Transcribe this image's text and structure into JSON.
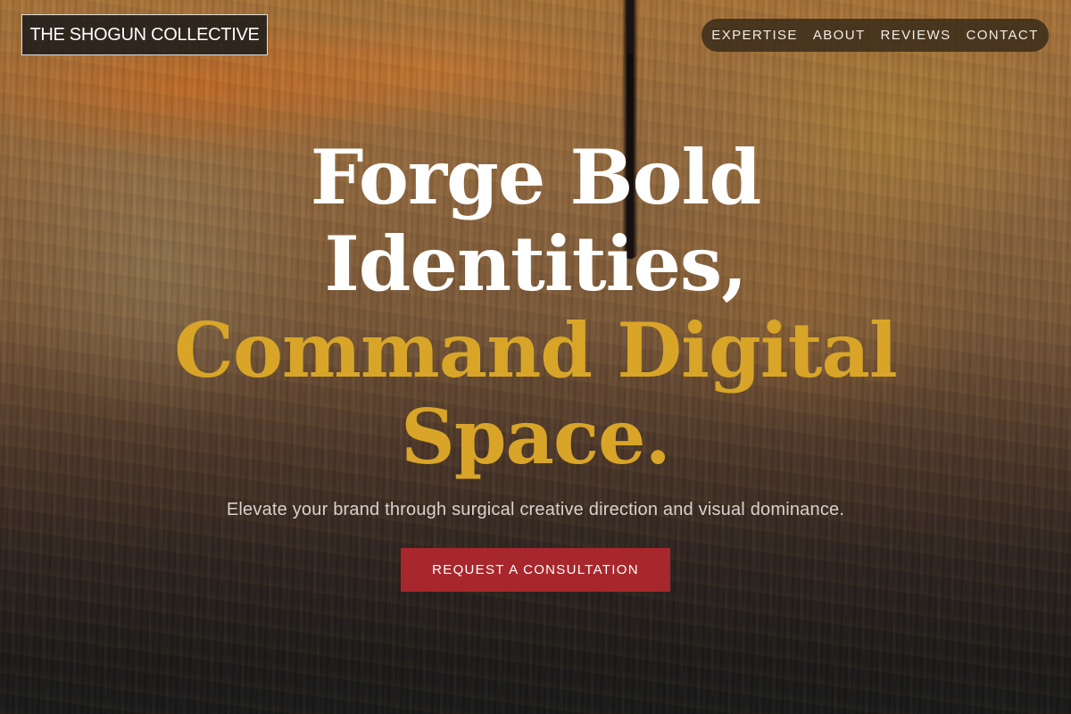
{
  "brand": {
    "logo_text": "THE SHOGUN COLLECTIVE"
  },
  "nav": {
    "items": [
      {
        "label": "EXPERTISE"
      },
      {
        "label": "ABOUT"
      },
      {
        "label": "REVIEWS"
      },
      {
        "label": "CONTACT"
      }
    ]
  },
  "hero": {
    "headline_line1": "Forge Bold",
    "headline_line2": "Identities,",
    "headline_line3": "Command Digital",
    "headline_line4": "Space.",
    "subtitle": "Elevate your brand through surgical creative direction and visual dominance.",
    "cta_label": "REQUEST A CONSULTATION"
  },
  "colors": {
    "accent_gold": "#d8a528",
    "cta_red": "#a8272c",
    "headline_white": "#ffffff",
    "nav_pill": "#3a2c1a"
  }
}
